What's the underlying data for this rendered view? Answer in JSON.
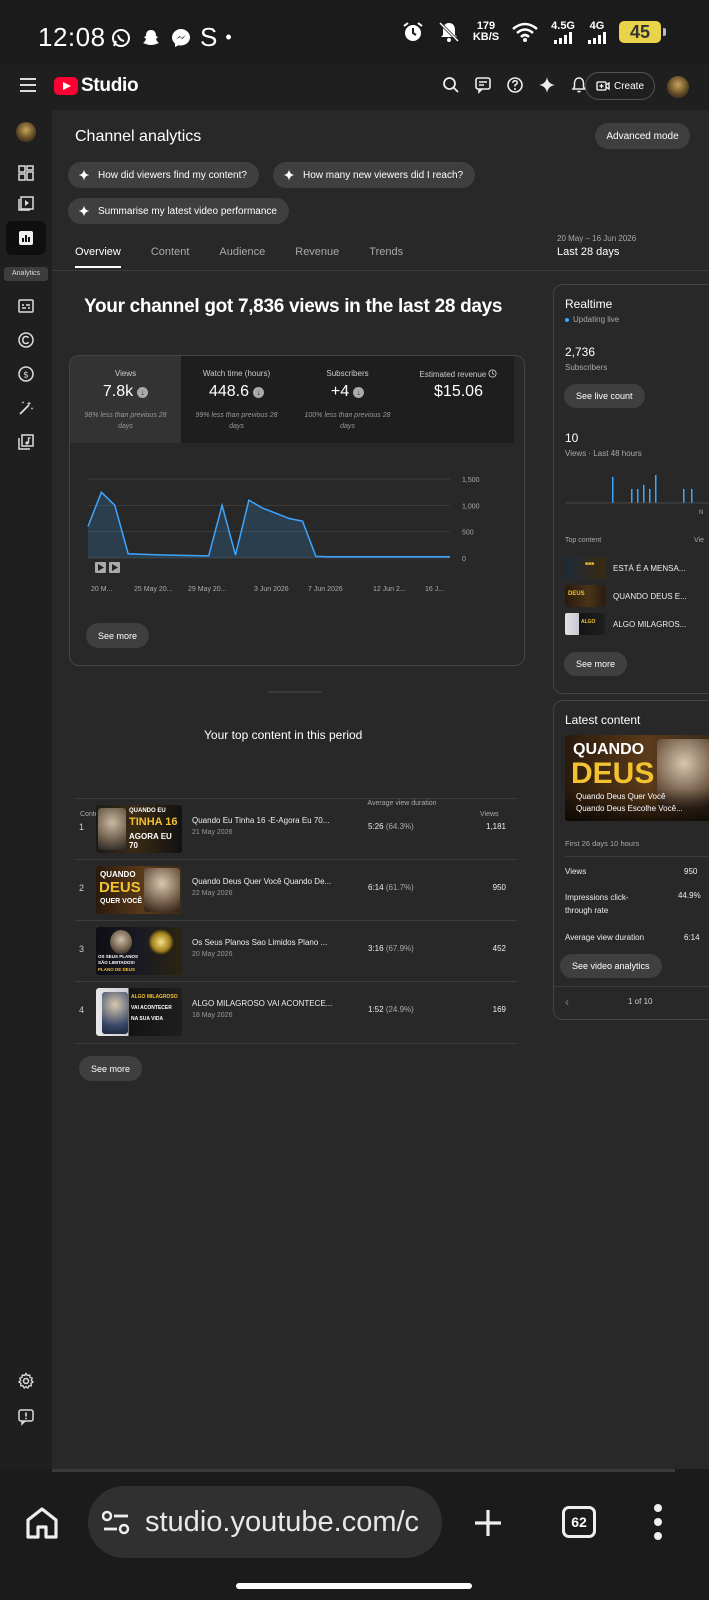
{
  "status_bar": {
    "time": "12:08",
    "left_icons": [
      "whatsapp-icon",
      "snapchat-icon",
      "messenger-icon",
      "s-icon",
      "dot-icon"
    ],
    "data_rate_value": "179",
    "data_rate_unit": "KB/S",
    "net_1": "4.5G",
    "net_2": "4G",
    "battery": "45"
  },
  "topbar": {
    "brand": "Studio",
    "create_label": "Create"
  },
  "sidenav": {
    "active_label": "Analytics"
  },
  "page": {
    "title": "Channel analytics",
    "advanced_mode": "Advanced mode",
    "chips": [
      "How did viewers find my content?",
      "How many new viewers did I reach?",
      "Summarise my latest video performance"
    ],
    "tabs": [
      "Overview",
      "Content",
      "Audience",
      "Revenue",
      "Trends"
    ],
    "active_tab": "Overview",
    "range_dates": "20 May – 16 Jun 2026",
    "range_label": "Last 28 days",
    "headline": "Your channel got 7,836 views in the last 28 days"
  },
  "metrics": [
    {
      "label": "Views",
      "value": "7.8k",
      "sub": "98% less than previous 28 days",
      "trend": "down"
    },
    {
      "label": "Watch time (hours)",
      "value": "448.6",
      "sub": "99% less than previous 28 days",
      "trend": "down"
    },
    {
      "label": "Subscribers",
      "value": "+4",
      "sub": "100% less than previous 28 days",
      "trend": "down"
    },
    {
      "label": "Estimated revenue",
      "value": "$15.06",
      "sub": "",
      "trend": "none"
    }
  ],
  "chart_data": {
    "type": "area",
    "title": "",
    "x_tick_labels": [
      "20 M...",
      "25 May 20...",
      "29 May 20...",
      "3 Jun 2026",
      "7 Jun 2026",
      "12 Jun 2...",
      "16 J..."
    ],
    "y_tick_labels": [
      "1,500",
      "1,000",
      "500",
      "0"
    ],
    "ylim": [
      0,
      1500
    ],
    "x": [
      "20 May",
      "21 May",
      "22 May",
      "23 May",
      "24 May",
      "25 May",
      "26 May",
      "27 May",
      "28 May",
      "29 May",
      "30 May",
      "31 May",
      "1 Jun",
      "2 Jun",
      "3 Jun",
      "4 Jun",
      "5 Jun",
      "6 Jun",
      "7 Jun",
      "8 Jun",
      "9 Jun",
      "10 Jun",
      "11 Jun",
      "12 Jun",
      "13 Jun",
      "14 Jun",
      "15 Jun",
      "16 Jun"
    ],
    "series": [
      {
        "values": [
          600,
          1250,
          1000,
          80,
          70,
          60,
          55,
          50,
          45,
          40,
          1000,
          55,
          1100,
          950,
          850,
          750,
          700,
          30,
          25,
          25,
          25,
          25,
          25,
          25,
          25,
          25,
          25,
          25
        ]
      }
    ],
    "grid": true,
    "color": "#3ea6ff"
  },
  "chart_see_more": "See more",
  "top_content": {
    "title": "Your top content in this period",
    "col_content": "Content",
    "col_duration": "Average view duration",
    "col_views": "Views",
    "rows": [
      {
        "rank": "1",
        "title": "Quando Eu Tinha 16 -E-Agora Eu 70...",
        "date": "21 May 2026",
        "duration": "5:26",
        "pct": "(64.3%)",
        "views": "1,181",
        "thumb": [
          "QUANDO EU",
          "TINHA 16",
          "AGORA EU 70"
        ]
      },
      {
        "rank": "2",
        "title": "Quando Deus Quer Você Quando De...",
        "date": "22 May 2026",
        "duration": "6:14",
        "pct": "(61.7%)",
        "views": "950",
        "thumb": [
          "QUANDO",
          "DEUS",
          "QUER VOCÊ"
        ]
      },
      {
        "rank": "3",
        "title": "Os Seus Planos Sao Limidos Plano ...",
        "date": "20 May 2026",
        "duration": "3:16",
        "pct": "(67.9%)",
        "views": "452",
        "thumb": [
          "OS SEUS PLANOS",
          "SÃO LIMITADOS!",
          "PLANO DE DEUS"
        ]
      },
      {
        "rank": "4",
        "title": "ALGO MILAGROSO VAI ACONTECE...",
        "date": "18 May 2026",
        "duration": "1:52",
        "pct": "(24.9%)",
        "views": "169",
        "thumb": [
          "ALGO MILAGROSO",
          "VAI ACONTECER",
          "NA SUA VIDA"
        ]
      }
    ],
    "see_more": "See more"
  },
  "realtime": {
    "title": "Realtime",
    "status": "Updating live",
    "subscribers_value": "2,736",
    "subscribers_label": "Subscribers",
    "see_live": "See live count",
    "views_value": "10",
    "views_label": "Views · Last 48 hours",
    "axis_label": "N",
    "top_content_label": "Top content",
    "top_content_col": "Vie",
    "items": [
      "ESTÁ É A MENSA...",
      "QUANDO DEUS E...",
      "ALGO MILAGROS..."
    ],
    "see_more": "See more"
  },
  "latest": {
    "title": "Latest content",
    "thumb_big": "QUANDO",
    "thumb_big2": "DEUS",
    "thumb_caption1": "Quando Deus Quer Você",
    "thumb_caption2": "Quando Deus Escolhe Você...",
    "period": "First 26 days 10 hours",
    "stats": [
      {
        "label": "Views",
        "value": "950"
      },
      {
        "label": "Impressions click-through rate",
        "value": "44.9%"
      },
      {
        "label": "Average view duration",
        "value": "6:14"
      }
    ],
    "see_video": "See video analytics",
    "pager": "1 of 10"
  },
  "browser": {
    "url": "studio.youtube.com/c",
    "tab_count": "62"
  }
}
